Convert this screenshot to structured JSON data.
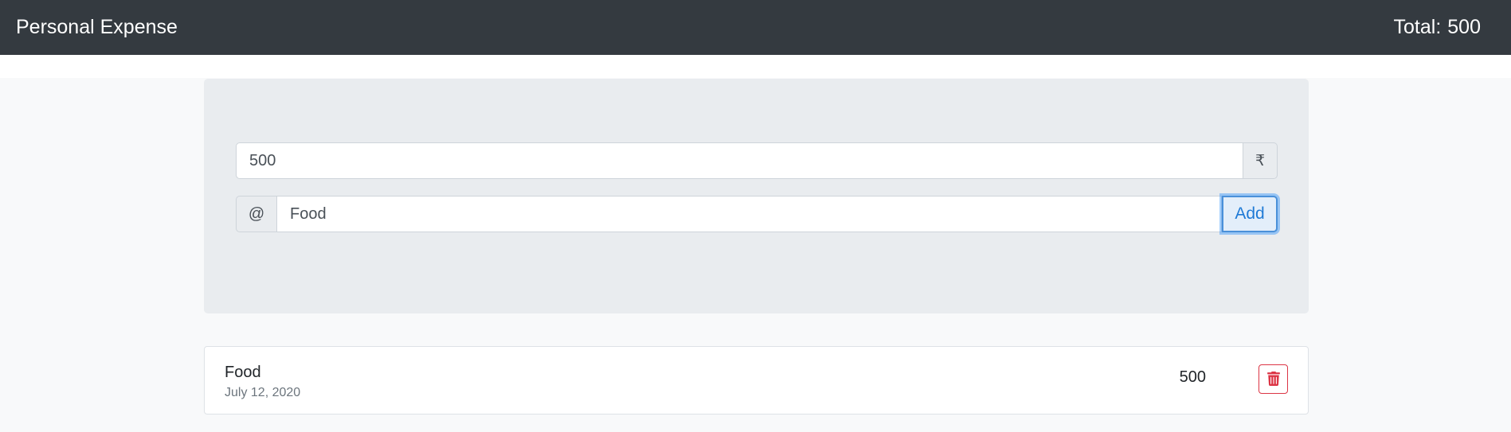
{
  "header": {
    "title": "Personal Expense",
    "total_label": "Total:",
    "total_value": "500"
  },
  "form": {
    "amount_value": "500",
    "currency_symbol": "₹",
    "prefix_symbol": "@",
    "description_value": "Food",
    "add_label": "Add"
  },
  "expenses": [
    {
      "name": "Food",
      "date": "July 12, 2020",
      "amount": "500",
      "delete_icon": "trash-icon"
    }
  ],
  "colors": {
    "navbar": "#343a40",
    "accent": "#007bff",
    "danger": "#dc3545"
  }
}
